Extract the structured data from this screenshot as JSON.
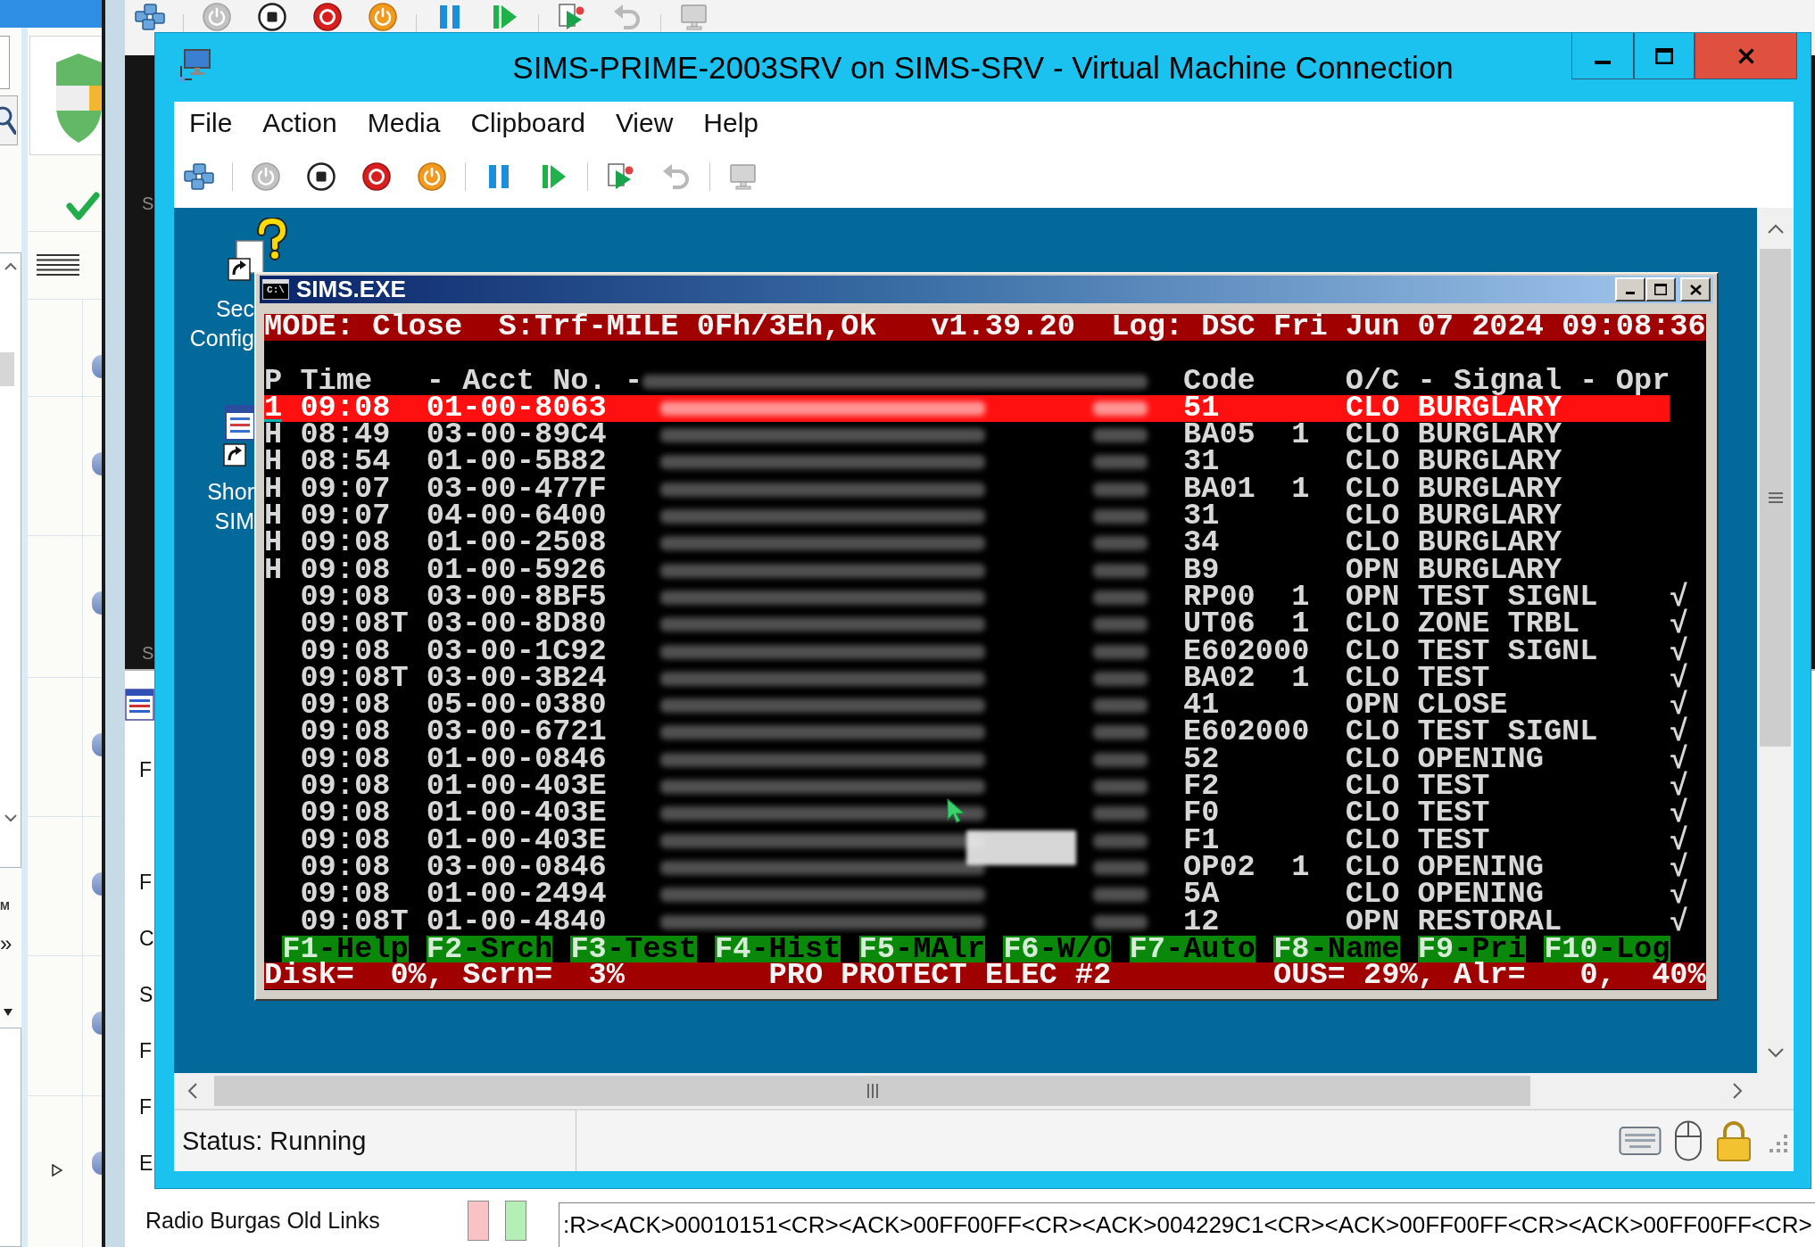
{
  "left_panel": {
    "fragment_text": "M",
    "more_glyph": "»"
  },
  "back_window": {
    "toolbar_groups": [
      {
        "buttons": [
          {
            "kind": "keys",
            "disabled": false
          }
        ]
      },
      {
        "buttons": [
          {
            "kind": "start",
            "disabled": true
          },
          {
            "kind": "stop",
            "disabled": false
          },
          {
            "kind": "turn-off",
            "disabled": false
          },
          {
            "kind": "shut-down",
            "disabled": false
          }
        ]
      },
      {
        "buttons": [
          {
            "kind": "pause",
            "disabled": false
          },
          {
            "kind": "resume",
            "disabled": false
          }
        ]
      },
      {
        "buttons": [
          {
            "kind": "checkpoint",
            "disabled": false
          },
          {
            "kind": "revert",
            "disabled": true
          }
        ]
      },
      {
        "buttons": [
          {
            "kind": "enhanced-session",
            "disabled": true
          }
        ]
      }
    ],
    "text_fragments": [
      "S",
      "S"
    ]
  },
  "lower_window": {
    "text_fragments": [
      "F",
      "F",
      "C",
      "S",
      "F",
      "F",
      "E"
    ],
    "label": "Radio Burgas Old Links",
    "indicators": [
      {
        "color": "#f9c3c6"
      },
      {
        "color": "#b5efb5"
      }
    ],
    "log_field": {
      "value": ":R><ACK>00010151<CR><ACK>00FF00FF<CR><ACK>004229C1<CR><ACK>00FF00FF<CR><ACK>00FF00FF<CR>"
    }
  },
  "vm_window": {
    "title": "SIMS-PRIME-2003SRV on SIMS-SRV - Virtual Machine Connection",
    "menu": [
      "File",
      "Action",
      "Media",
      "Clipboard",
      "View",
      "Help"
    ],
    "toolbar_groups": [
      {
        "buttons": [
          {
            "kind": "keys",
            "disabled": false
          }
        ]
      },
      {
        "buttons": [
          {
            "kind": "start",
            "disabled": true
          },
          {
            "kind": "stop",
            "disabled": false
          },
          {
            "kind": "turn-off",
            "disabled": false
          },
          {
            "kind": "shut-down",
            "disabled": false
          }
        ]
      },
      {
        "buttons": [
          {
            "kind": "pause",
            "disabled": false
          },
          {
            "kind": "resume",
            "disabled": false
          }
        ]
      },
      {
        "buttons": [
          {
            "kind": "checkpoint",
            "disabled": false
          },
          {
            "kind": "revert",
            "disabled": true
          }
        ]
      },
      {
        "buttons": [
          {
            "kind": "enhanced-session",
            "disabled": true
          }
        ]
      }
    ],
    "desktop_icons": [
      {
        "kind": "help",
        "label_lines": [
          "Sec",
          "Config"
        ]
      },
      {
        "kind": "app",
        "label_lines": [
          "Shor",
          "SIM"
        ]
      }
    ],
    "console": {
      "title": "SIMS.EXE",
      "icon_text": "C:\\",
      "mode_line": {
        "mode": "MODE: Close",
        "state": "S:Trf-MILE 0Fh/3Eh,Ok",
        "version": "v1.39.20",
        "log": "Log: DSC Fri Jun 07 2024 09:08:36"
      },
      "columns": {
        "p": "P",
        "time": "Time",
        "account": "- Acct No. -",
        "code": "Code",
        "oc": "O/C",
        "signal": "- Signal -",
        "opr": "Opr"
      },
      "rows": [
        {
          "p": "1",
          "time": "09:08",
          "account": "01-00-8063",
          "code": "51",
          "oc": "CLO",
          "signal": "BURGLARY",
          "selected": true
        },
        {
          "p": "H",
          "time": "08:49",
          "account": "03-00-89C4",
          "code": "BA05",
          "zone": "1",
          "oc": "CLO",
          "signal": "BURGLARY",
          "selected": false
        },
        {
          "p": "H",
          "time": "08:54",
          "account": "01-00-5B82",
          "code": "31",
          "oc": "CLO",
          "signal": "BURGLARY",
          "selected": false
        },
        {
          "p": "H",
          "time": "09:07",
          "account": "03-00-477F",
          "code": "BA01",
          "zone": "1",
          "oc": "CLO",
          "signal": "BURGLARY",
          "selected": false
        },
        {
          "p": "H",
          "time": "09:07",
          "account": "04-00-6400",
          "code": "31",
          "oc": "CLO",
          "signal": "BURGLARY",
          "selected": false
        },
        {
          "p": "H",
          "time": "09:08",
          "account": "01-00-2508",
          "code": "34",
          "oc": "CLO",
          "signal": "BURGLARY",
          "selected": false
        },
        {
          "p": "H",
          "time": "09:08",
          "account": "01-00-5926",
          "code": "B9",
          "oc": "OPN",
          "signal": "BURGLARY",
          "selected": false
        },
        {
          "time": "09:08",
          "account": "03-00-8BF5",
          "code": "RP00",
          "zone": "1",
          "oc": "OPN",
          "signal": "TEST SIGNL",
          "opr": "√",
          "selected": false
        },
        {
          "time": "09:08T",
          "account": "03-00-8D80",
          "code": "UT06",
          "zone": "1",
          "oc": "CLO",
          "signal": "ZONE TRBL",
          "opr": "√",
          "selected": false
        },
        {
          "time": "09:08",
          "account": "03-00-1C92",
          "code": "E602000",
          "oc": "CLO",
          "signal": "TEST SIGNL",
          "opr": "√",
          "selected": false
        },
        {
          "time": "09:08T",
          "account": "03-00-3B24",
          "code": "BA02",
          "zone": "1",
          "oc": "CLO",
          "signal": "TEST",
          "opr": "√",
          "selected": false
        },
        {
          "time": "09:08",
          "account": "05-00-0380",
          "code": "41",
          "oc": "OPN",
          "signal": "CLOSE",
          "opr": "√",
          "selected": false
        },
        {
          "time": "09:08",
          "account": "03-00-6721",
          "code": "E602000",
          "oc": "CLO",
          "signal": "TEST SIGNL",
          "opr": "√",
          "selected": false
        },
        {
          "time": "09:08",
          "account": "01-00-0846",
          "code": "52",
          "oc": "CLO",
          "signal": "OPENING",
          "opr": "√",
          "selected": false
        },
        {
          "time": "09:08",
          "account": "01-00-403E",
          "code": "F2",
          "oc": "CLO",
          "signal": "TEST",
          "opr": "√",
          "selected": false
        },
        {
          "time": "09:08",
          "account": "01-00-403E",
          "code": "F0",
          "oc": "CLO",
          "signal": "TEST",
          "opr": "√",
          "selected": false
        },
        {
          "time": "09:08",
          "account": "01-00-403E",
          "code": "F1",
          "oc": "CLO",
          "signal": "TEST",
          "opr": "√",
          "selected": false
        },
        {
          "time": "09:08",
          "account": "03-00-0846",
          "code": "OP02",
          "zone": "1",
          "oc": "CLO",
          "signal": "OPENING",
          "opr": "√",
          "selected": false
        },
        {
          "time": "09:08",
          "account": "01-00-2494",
          "code": "5A",
          "oc": "CLO",
          "signal": "OPENING",
          "opr": "√",
          "selected": false
        },
        {
          "time": "09:08T",
          "account": "01-00-4840",
          "code": "12",
          "oc": "OPN",
          "signal": "RESTORAL",
          "opr": "√",
          "selected": false
        }
      ],
      "function_keys": [
        {
          "key": "F1",
          "label": "-Help"
        },
        {
          "key": "F2",
          "label": "-Srch"
        },
        {
          "key": "F3",
          "label": "-Test"
        },
        {
          "key": "F4",
          "label": "-Hist"
        },
        {
          "key": "F5",
          "label": "-MAlr"
        },
        {
          "key": "F6",
          "label": "-W/O"
        },
        {
          "key": "F7",
          "label": "-Auto"
        },
        {
          "key": "F8",
          "label": "-Name"
        },
        {
          "key": "F9",
          "label": "-Pri"
        },
        {
          "key": "F10",
          "label": "-Log"
        }
      ],
      "status_line": {
        "usage": "Disk=  0%, Scrn=  3%",
        "site": "PRO PROTECT ELEC #2",
        "counters": "OUS= 29%, Alr=   0,  40%"
      }
    },
    "status_bar": {
      "status": "Status: Running"
    }
  }
}
